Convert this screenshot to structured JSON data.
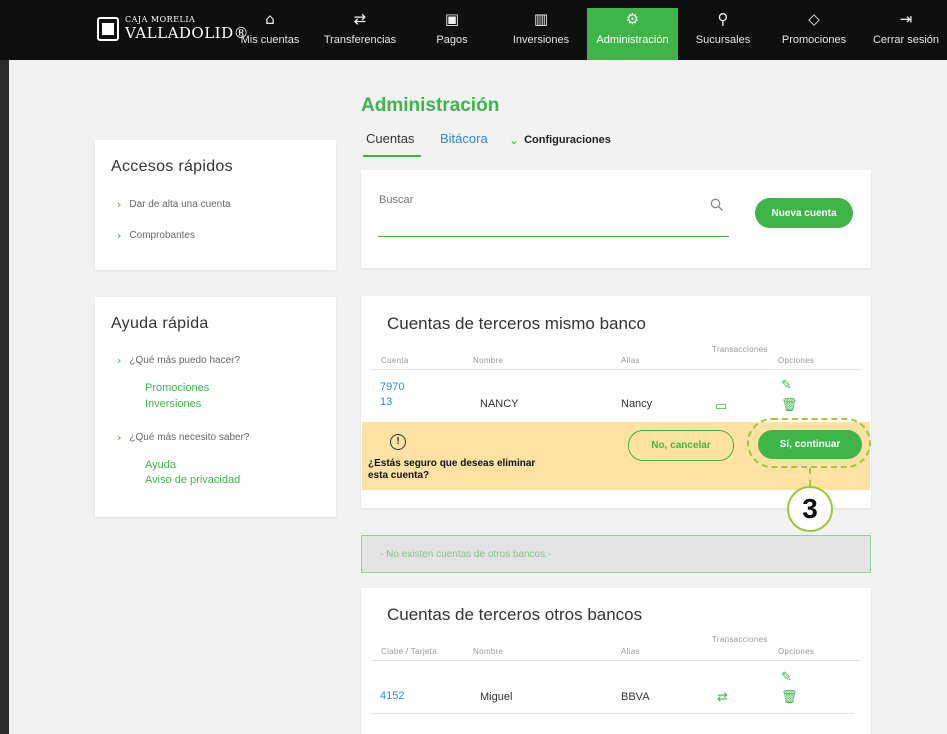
{
  "brand": {
    "line1": "CAJA MORELIA",
    "line2": "VALLADOLID®"
  },
  "nav": [
    {
      "label": "Mis cuentas",
      "icon": "home-icon",
      "glyph": "⌂"
    },
    {
      "label": "Transferencias",
      "icon": "transfer-icon",
      "glyph": "⇄"
    },
    {
      "label": "Pagos",
      "icon": "payments-icon",
      "glyph": "▣"
    },
    {
      "label": "Inversiones",
      "icon": "investments-icon",
      "glyph": "▥"
    },
    {
      "label": "Administración",
      "icon": "gear-icon",
      "glyph": "⚙",
      "active": true
    },
    {
      "label": "Sucursales",
      "icon": "location-pin-icon",
      "glyph": "⚲"
    },
    {
      "label": "Promociones",
      "icon": "tag-icon",
      "glyph": "◇"
    },
    {
      "label": "Cerrar sesión",
      "icon": "logout-icon",
      "glyph": "⇥"
    }
  ],
  "quick_access": {
    "title": "Accesos rápidos",
    "links": [
      "Dar de alta una cuenta",
      "Comprobantes"
    ]
  },
  "quick_help": {
    "title": "Ayuda rápida",
    "q1": "¿Qué más puedo hacer?",
    "q1_links": [
      "Promociones",
      "Inversiones"
    ],
    "q2": "¿Qué más necesito saber?",
    "q2_links": [
      "Ayuda",
      "Aviso de privacidad"
    ]
  },
  "page": {
    "title": "Administración",
    "tabs": [
      "Cuentas",
      "Bitácora",
      "Configuraciones"
    ]
  },
  "search": {
    "label": "Buscar",
    "button": "Nueva cuenta"
  },
  "same_bank": {
    "title": "Cuentas de terceros mismo banco",
    "headers": [
      "Cuenta",
      "Nombre",
      "Alias",
      "Transacciones",
      "Opciones"
    ],
    "row": {
      "account_line1": "7970",
      "account_line2": "13",
      "name": "NANCY",
      "alias": "Nancy"
    },
    "confirm": {
      "warning_mark": "!",
      "question": "¿Estás seguro que deseas eliminar esta cuenta?",
      "cancel": "No, cancelar",
      "continue": "Sí, continuar"
    }
  },
  "step_number": "3",
  "notice": "- No existen cuentas de otros bancos -",
  "other_banks": {
    "title": "Cuentas de terceros otros bancos",
    "headers": [
      "Clabe / Tarjeta",
      "Nombre",
      "Alias",
      "Transacciones",
      "Opciones"
    ],
    "row": {
      "account": "4152",
      "name": "Miguel",
      "alias": "BBVA"
    }
  },
  "colors": {
    "accent": "#3fb549",
    "warning_band": "#fde2a4",
    "highlight": "#9cc93a"
  }
}
